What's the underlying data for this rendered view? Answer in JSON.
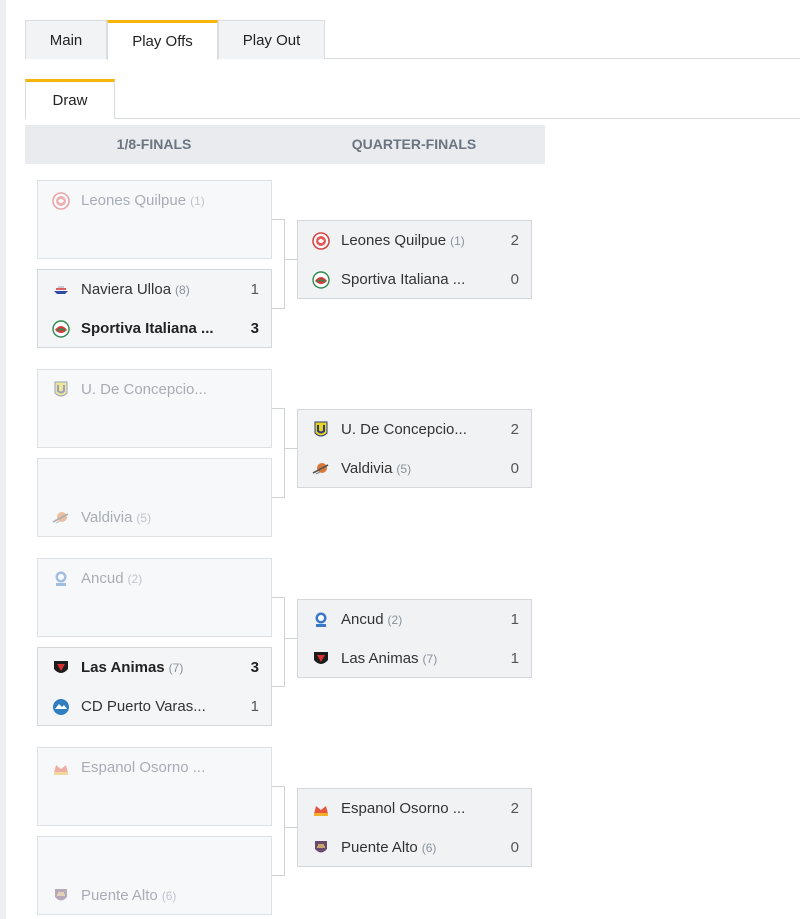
{
  "tabs": {
    "main": "Main",
    "playoffs": "Play Offs",
    "playout": "Play Out"
  },
  "subtabs": {
    "draw": "Draw"
  },
  "rounds": {
    "r16": "1/8-FINALS",
    "qf": "QUARTER-FINALS"
  },
  "r16": [
    {
      "top": {
        "name": "Leones Quilpue",
        "seed": "(1)",
        "score": ""
      },
      "bottom": {
        "name": "",
        "seed": "",
        "score": ""
      }
    },
    {
      "top": {
        "name": "Naviera Ulloa",
        "seed": "(8)",
        "score": "1"
      },
      "bottom": {
        "name": "Sportiva Italiana ...",
        "seed": "",
        "score": "3"
      }
    },
    {
      "top": {
        "name": "U. De Concepcio...",
        "seed": "",
        "score": ""
      },
      "bottom": {
        "name": "",
        "seed": "",
        "score": ""
      }
    },
    {
      "top": {
        "name": "",
        "seed": "",
        "score": ""
      },
      "bottom": {
        "name": "Valdivia",
        "seed": "(5)",
        "score": ""
      }
    },
    {
      "top": {
        "name": "Ancud",
        "seed": "(2)",
        "score": ""
      },
      "bottom": {
        "name": "",
        "seed": "",
        "score": ""
      }
    },
    {
      "top": {
        "name": "Las Animas",
        "seed": "(7)",
        "score": "3"
      },
      "bottom": {
        "name": "CD Puerto Varas...",
        "seed": "",
        "score": "1"
      }
    },
    {
      "top": {
        "name": "Espanol Osorno ...",
        "seed": "",
        "score": ""
      },
      "bottom": {
        "name": "",
        "seed": "",
        "score": ""
      }
    },
    {
      "top": {
        "name": "",
        "seed": "",
        "score": ""
      },
      "bottom": {
        "name": "Puente Alto",
        "seed": "(6)",
        "score": ""
      }
    }
  ],
  "qf": [
    {
      "top": {
        "name": "Leones Quilpue",
        "seed": "(1)",
        "score": "2"
      },
      "bottom": {
        "name": "Sportiva Italiana ...",
        "seed": "",
        "score": "0"
      }
    },
    {
      "top": {
        "name": "U. De Concepcio...",
        "seed": "",
        "score": "2"
      },
      "bottom": {
        "name": "Valdivia",
        "seed": "(5)",
        "score": "0"
      }
    },
    {
      "top": {
        "name": "Ancud",
        "seed": "(2)",
        "score": "1"
      },
      "bottom": {
        "name": "Las Animas",
        "seed": "(7)",
        "score": "1"
      }
    },
    {
      "top": {
        "name": "Espanol Osorno ...",
        "seed": "",
        "score": "2"
      },
      "bottom": {
        "name": "Puente Alto",
        "seed": "(6)",
        "score": "0"
      }
    }
  ],
  "colors": {
    "accent": "#f5b50a",
    "header_bg": "#e9ebee",
    "card_bg": "#f4f5f7",
    "border": "#d4d8dd"
  }
}
